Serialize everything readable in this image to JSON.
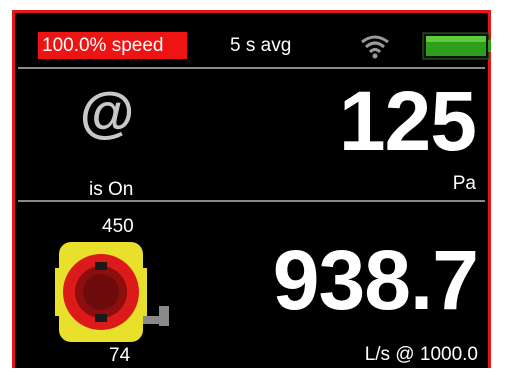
{
  "status_bar": {
    "speed_label": "100.0% speed",
    "avg_label": "5 s avg",
    "wifi_icon": "wifi-icon",
    "battery_icon": "battery-icon",
    "battery_color": "#2f9e1b",
    "speed_badge_color": "#ee1414"
  },
  "pressure_panel": {
    "mode_icon": "at-sign-icon",
    "status_text": "is On",
    "value": "125",
    "unit": "Pa"
  },
  "flow_panel": {
    "device_icon": "tape-measure-icon",
    "range_max": "450",
    "range_min": "74",
    "value": "938.7",
    "unit": "L/s @ 1000.0"
  },
  "frame_color": "#e31717"
}
